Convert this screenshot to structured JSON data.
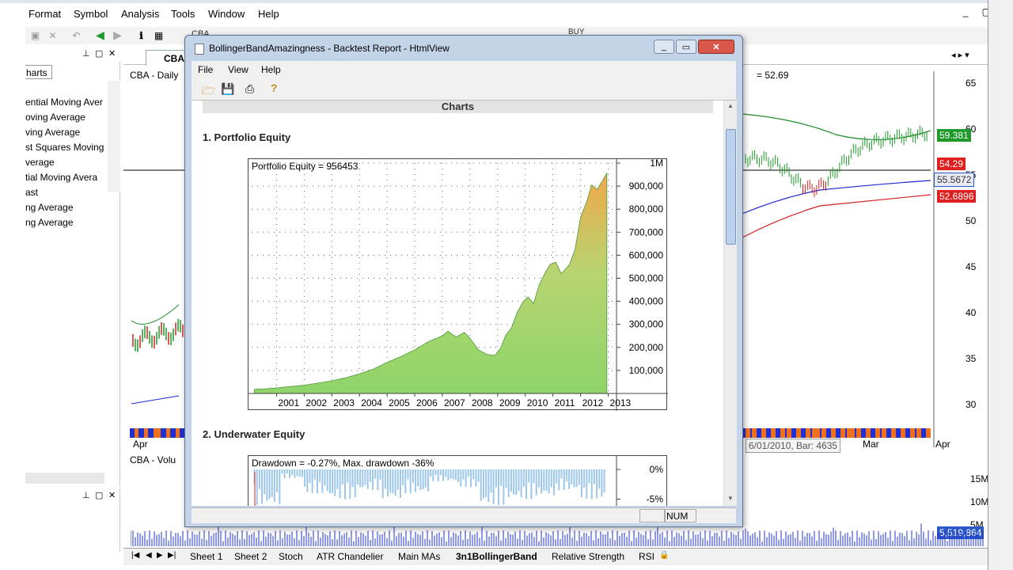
{
  "menubar": {
    "items": [
      "Format",
      "Symbol",
      "Analysis",
      "Tools",
      "Window",
      "Help"
    ],
    "window_controls": [
      "_",
      "▢"
    ]
  },
  "toolbar": {
    "symbol_value": "CBA",
    "buy_label": "BUY"
  },
  "left_panel": {
    "tab_label": "harts",
    "indicators": [
      "ential Moving Aver",
      "oving Average",
      "ving Average",
      "st Squares Moving",
      "verage",
      "tial Moving Avera",
      "ast",
      "ng Average",
      "ng Average"
    ]
  },
  "chart_window": {
    "tab_label": "CBA",
    "title": "CBA - Daily",
    "price_readout": "= 52.69",
    "volume_title": "CBA - Volu",
    "date_labels": [
      "Apr",
      "Mar",
      "Apr"
    ],
    "tooltip": "6/01/2010, Bar: 4635",
    "price_axis": [
      "65",
      "60",
      "55",
      "50",
      "45",
      "40",
      "35",
      "30"
    ],
    "price_tags": {
      "green": "59.381",
      "red_top": "54.29",
      "blue": "55.5672",
      "red_bottom": "52.6896"
    },
    "volume_axis": [
      "15M",
      "10M",
      "5M"
    ],
    "volume_tag": "5,519,864",
    "colors": {
      "upper_band": "#1e8c2c",
      "middle_band": "#1a2ad0",
      "lower_band": "#d42020",
      "tag_green": "#1e9a2a",
      "tag_red": "#e02020",
      "tag_blue": "#2a58c8"
    }
  },
  "sheet_tabs": {
    "tabs": [
      "Sheet 1",
      "Sheet 2",
      "Stoch",
      "ATR Chandelier",
      "Main MAs",
      "3n1BollingerBand",
      "Relative Strength",
      "RSI"
    ],
    "active": "3n1BollingerBand"
  },
  "dialog": {
    "title": "BollingerBandAmazingness - Backtest Report - HtmlView",
    "menu": [
      "File",
      "View",
      "Help"
    ],
    "section_heading": "Charts",
    "section1_title": "1. Portfolio Equity",
    "section2_title": "2. Underwater Equity",
    "equity_caption": "Portfolio Equity = 956453",
    "drawdown_caption": "Drawdown = -0.27%, Max. drawdown -36%",
    "drawdown_axis": [
      "0%",
      "-5%"
    ],
    "status_num": "NUM"
  },
  "chart_data": [
    {
      "type": "area",
      "title": "Portfolio Equity = 956453",
      "xlabel": "",
      "ylabel": "",
      "x_ticks": [
        "2001",
        "2002",
        "2003",
        "2004",
        "2005",
        "2006",
        "2007",
        "2008",
        "2009",
        "2010",
        "2011",
        "2012",
        "2013"
      ],
      "y_ticks": [
        "100,000",
        "200,000",
        "300,000",
        "400,000",
        "500,000",
        "600,000",
        "700,000",
        "800,000",
        "900,000",
        "1M"
      ],
      "ylim": [
        0,
        1000000
      ],
      "xlim": [
        2000.1,
        2013.3
      ],
      "grid": true,
      "x": [
        2000.2,
        2000.6,
        2001.0,
        2001.5,
        2002.0,
        2002.5,
        2003.0,
        2003.5,
        2004.0,
        2004.5,
        2005.0,
        2005.5,
        2006.0,
        2006.5,
        2007.0,
        2007.2,
        2007.5,
        2007.8,
        2008.0,
        2008.3,
        2008.6,
        2008.9,
        2009.1,
        2009.3,
        2009.5,
        2009.7,
        2009.9,
        2010.1,
        2010.3,
        2010.5,
        2010.7,
        2010.9,
        2011.1,
        2011.3,
        2011.5,
        2011.6,
        2011.8,
        2012.0,
        2012.2,
        2012.4,
        2012.6,
        2012.8,
        2012.95
      ],
      "values": [
        18000,
        20000,
        24000,
        30000,
        36000,
        45000,
        55000,
        68000,
        85000,
        105000,
        135000,
        160000,
        190000,
        225000,
        250000,
        270000,
        245000,
        265000,
        240000,
        190000,
        170000,
        165000,
        195000,
        255000,
        285000,
        350000,
        395000,
        420000,
        390000,
        470000,
        520000,
        560000,
        570000,
        520000,
        545000,
        560000,
        625000,
        765000,
        825000,
        905000,
        885000,
        925000,
        956453
      ],
      "series": [
        {
          "name": "Portfolio Equity",
          "color_top": "#f0a84a",
          "color_bottom": "#8ed46a"
        }
      ]
    },
    {
      "type": "area",
      "title": "Drawdown = -0.27%, Max. drawdown -36%",
      "y_ticks": [
        "0%",
        "-5%"
      ],
      "ylim": [
        -6,
        0
      ],
      "x": [
        2000.2,
        2000.5,
        2001.0,
        2002.0,
        2003.0,
        2004.0,
        2005.0,
        2006.0,
        2007.0,
        2008.0,
        2009.0,
        2010.0,
        2011.0,
        2012.0,
        2012.95
      ],
      "values": [
        -6,
        -1.5,
        -4,
        -5,
        -3.5,
        -5,
        -4,
        -2,
        -3,
        -6,
        -5,
        -4.5,
        -3.5,
        -5,
        -0.27
      ]
    }
  ]
}
